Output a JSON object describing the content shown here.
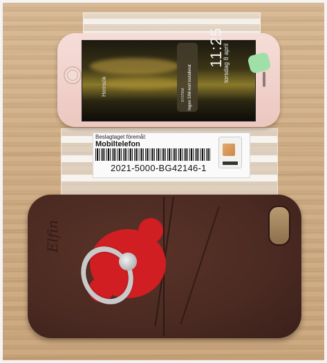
{
  "phone": {
    "time": "11:25",
    "date": "torsdag 8 april",
    "notification_app": "SYSTEM",
    "notification_body": "Ingen SIM-kort installerat",
    "unlock_hint": "Hemsök"
  },
  "evidence_label": {
    "heading": "Beslagtaget föremål:",
    "item": "Mobiltelefon",
    "reference": "2021-5000-BG42146-1"
  },
  "case": {
    "logo_text": "Elfin"
  },
  "colors": {
    "case_leather": "#4a2a22",
    "bear_grip": "#d01e22",
    "phone_body": "#ecc7c0",
    "wood": "#cfae87"
  }
}
